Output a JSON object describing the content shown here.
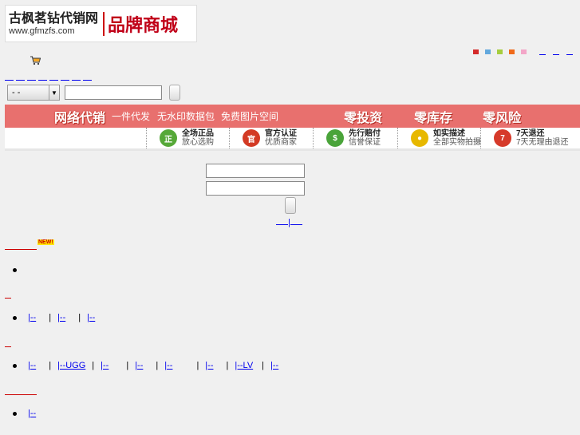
{
  "logo": {
    "chinese": "古枫茗钻代销网",
    "url": "www.gfmzfs.com",
    "mall": "品牌商城"
  },
  "swatches": [
    "#d42a2a",
    "#62a8dd",
    "#a6cd3e",
    "#f06a1a",
    "#f3a6c8"
  ],
  "search": {
    "select_value": "-  -"
  },
  "banner": {
    "title": "网络代销",
    "subs": [
      "一件代发",
      "无水印数据包",
      "免费图片空间"
    ],
    "bigs": [
      "零投资",
      "零库存",
      "零风险"
    ]
  },
  "features": [
    {
      "icon": "genuine-icon",
      "color": "#56a838",
      "glyph": "正",
      "t1": "全场正品",
      "t2": "放心选购"
    },
    {
      "icon": "official-icon",
      "color": "#d33a24",
      "glyph": "官",
      "t1": "官方认证",
      "t2": "优质商家"
    },
    {
      "icon": "payment-icon",
      "color": "#4aa43a",
      "glyph": "$",
      "t1": "先行赔付",
      "t2": "信誉保证"
    },
    {
      "icon": "photo-icon",
      "color": "#e7b800",
      "glyph": "●",
      "t1": "如实描述",
      "t2": "全部实物拍摄"
    },
    {
      "icon": "return-icon",
      "color": "#d63a2a",
      "glyph": "7",
      "t1": "7天退还",
      "t2": "7天无理由退还"
    }
  ],
  "login": {
    "separator": "|"
  },
  "badge_new": "NEW!",
  "category_links": {
    "c2": [
      "|--",
      "|--",
      "|--"
    ],
    "c3": [
      "|--",
      "|--UGG",
      "|--",
      "|--",
      "|--",
      "|--",
      "|--LV",
      "|--"
    ],
    "c4": [
      "|--"
    ]
  }
}
